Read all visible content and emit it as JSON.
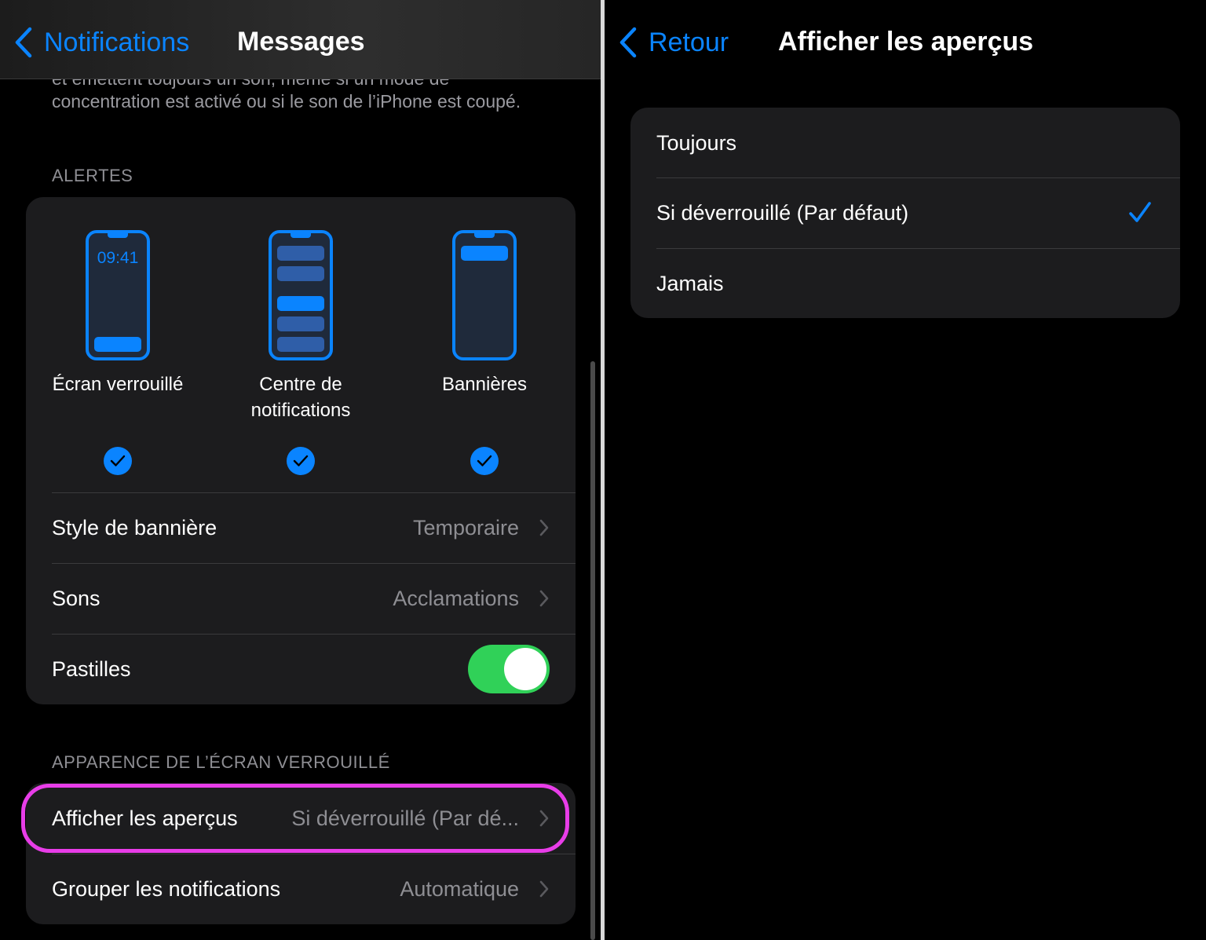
{
  "colors": {
    "accent": "#0a84ff",
    "toggle_on": "#30d158",
    "highlight": "#e83de8",
    "background": "#000000",
    "group_bg": "#1c1c1e"
  },
  "left": {
    "nav": {
      "back_label": "Notifications",
      "title": "Messages",
      "back_icon": "chevron-left-icon"
    },
    "scrolled_text": "et émettent toujours un son, même si un mode de concentration est activé ou si le son de l’iPhone est coupé.",
    "alerts": {
      "header": "ALERTES",
      "styles": [
        {
          "label": "Écran verrouillé",
          "checked": true,
          "time": "09:41"
        },
        {
          "label": "Centre de notifications",
          "checked": true
        },
        {
          "label": "Bannières",
          "checked": true
        }
      ],
      "rows": {
        "banner_style": {
          "label": "Style de bannière",
          "value": "Temporaire"
        },
        "sounds": {
          "label": "Sons",
          "value": "Acclamations"
        },
        "badges": {
          "label": "Pastilles",
          "enabled": true
        }
      }
    },
    "lock_screen": {
      "header": "APPARENCE DE L’ÉCRAN VERROUILLÉ",
      "rows": {
        "show_previews": {
          "label": "Afficher les aperçus",
          "value": "Si déverrouillé (Par dé..."
        },
        "grouping": {
          "label": "Grouper les notifications",
          "value": "Automatique"
        }
      }
    }
  },
  "right": {
    "nav": {
      "back_label": "Retour",
      "title": "Afficher les aperçus",
      "back_icon": "chevron-left-icon"
    },
    "options": [
      {
        "label": "Toujours",
        "selected": false
      },
      {
        "label": "Si déverrouillé (Par défaut)",
        "selected": true
      },
      {
        "label": "Jamais",
        "selected": false
      }
    ]
  }
}
